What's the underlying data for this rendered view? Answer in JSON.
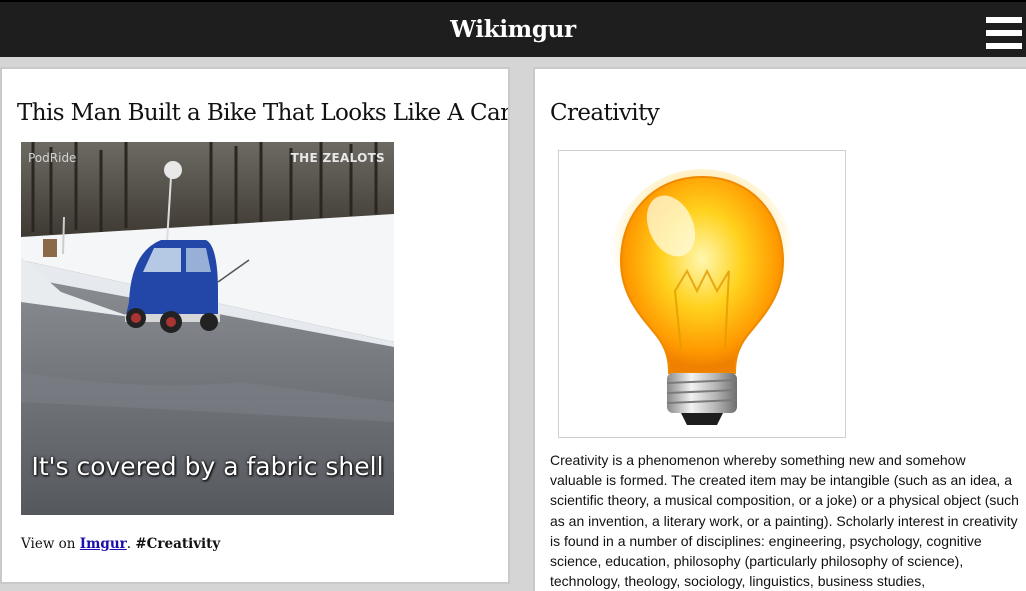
{
  "header": {
    "site_title": "Wikimgur",
    "menu_icon": "hamburger-menu-icon"
  },
  "left_card": {
    "title": "This Man Built a Bike That Looks Like A Car",
    "gif": {
      "watermark_left": "PodRide",
      "watermark_right": "THE ZEALOTS",
      "caption": "It's covered by a fabric shell"
    },
    "footer": {
      "prefix": "View on ",
      "link_label": "Imgur",
      "separator": ". ",
      "tag": "#Creativity"
    }
  },
  "right_card": {
    "title": "Creativity",
    "image_icon": "lightbulb-icon",
    "description": "Creativity is a phenomenon whereby something new and somehow valuable is formed. The created item may be intangible (such as an idea, a scientific theory, a musical composition, or a joke) or a physical object (such as an invention, a literary work, or a painting). Scholarly interest in creativity is found in a number of disciplines: engineering, psychology, cognitive science, education, philosophy (particularly philosophy of science), technology, theology, sociology, linguistics, business studies,"
  },
  "colors": {
    "topbar": "#1e1e1e",
    "link": "#1a0dab",
    "page_bg": "#d5d5d5"
  }
}
